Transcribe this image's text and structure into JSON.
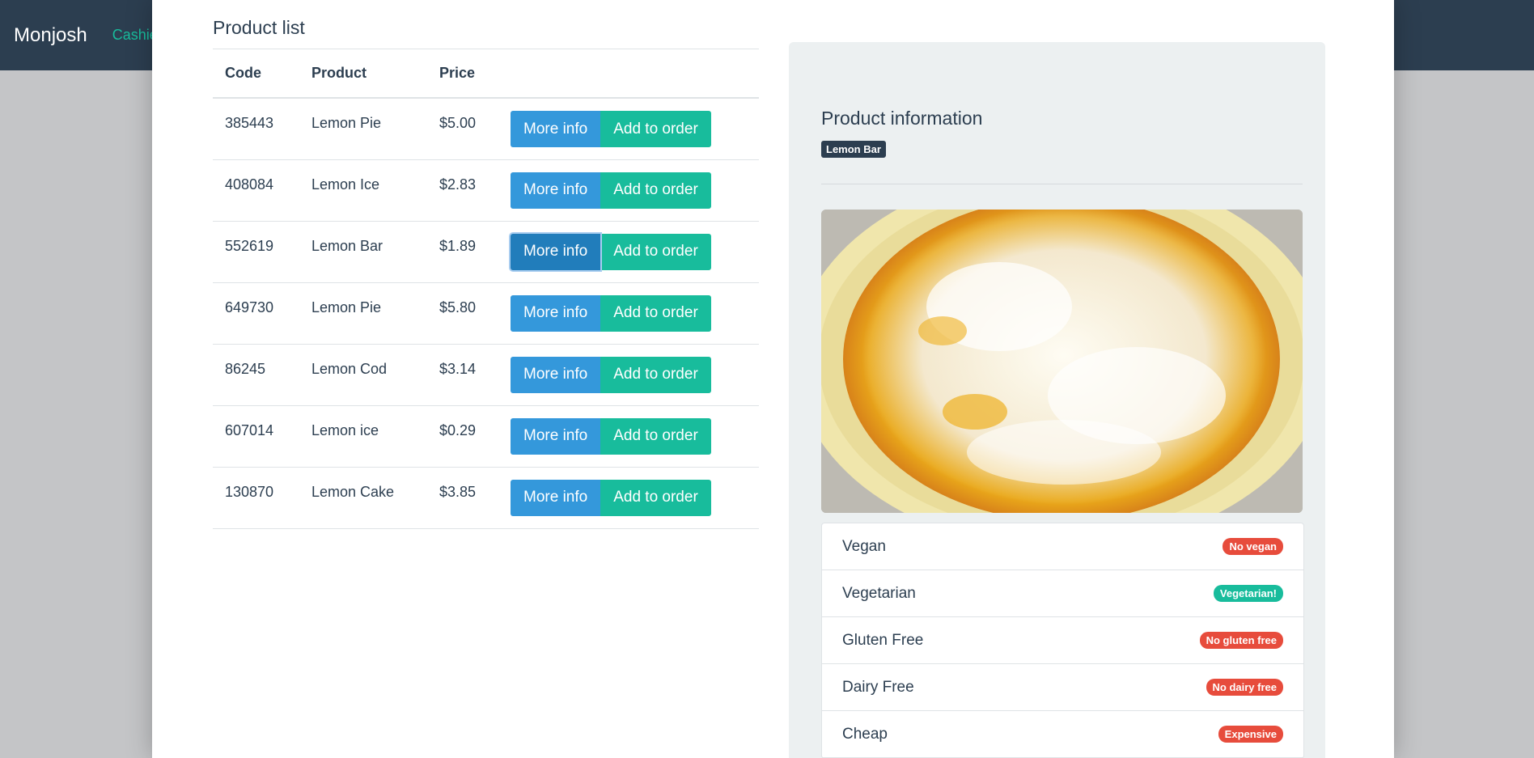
{
  "navbar": {
    "brand": "Monjosh",
    "link": "Cashie"
  },
  "product_list": {
    "title": "Product list",
    "columns": [
      "Code",
      "Product",
      "Price"
    ],
    "more_info_label": "More info",
    "add_label": "Add to order",
    "rows": [
      {
        "code": "385443",
        "product": "Lemon Pie",
        "price": "$5.00"
      },
      {
        "code": "408084",
        "product": "Lemon Ice",
        "price": "$2.83"
      },
      {
        "code": "552619",
        "product": "Lemon Bar",
        "price": "$1.89"
      },
      {
        "code": "649730",
        "product": "Lemon Pie",
        "price": "$5.80"
      },
      {
        "code": "86245",
        "product": "Lemon Cod",
        "price": "$3.14"
      },
      {
        "code": "607014",
        "product": "Lemon ice",
        "price": "$0.29"
      },
      {
        "code": "130870",
        "product": "Lemon Cake",
        "price": "$3.85"
      }
    ]
  },
  "product_info": {
    "title": "Product information",
    "selected_name": "Lemon Bar",
    "attributes": [
      {
        "label": "Vegan",
        "value": "No vegan",
        "status": "danger"
      },
      {
        "label": "Vegetarian",
        "value": "Vegetarian!",
        "status": "success"
      },
      {
        "label": "Gluten Free",
        "value": "No gluten free",
        "status": "danger"
      },
      {
        "label": "Dairy Free",
        "value": "No dairy free",
        "status": "danger"
      },
      {
        "label": "Cheap",
        "value": "Expensive",
        "status": "danger"
      }
    ]
  },
  "colors": {
    "navbar": "#2c3e50",
    "info": "#3498db",
    "success": "#18bc9c",
    "danger": "#e74c3c"
  }
}
